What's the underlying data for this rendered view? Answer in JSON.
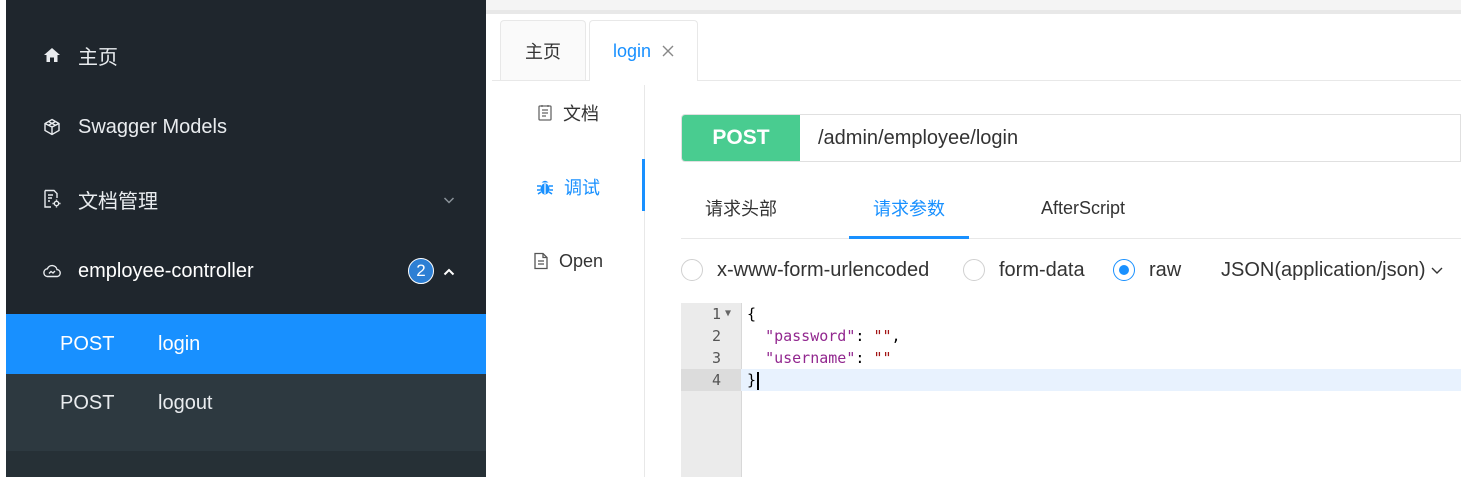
{
  "sidebar": {
    "items": [
      {
        "label": "主页",
        "icon": "home-icon"
      },
      {
        "label": "Swagger Models",
        "icon": "cube-icon"
      },
      {
        "label": "文档管理",
        "icon": "doc-settings-icon"
      },
      {
        "label": "employee-controller",
        "icon": "cloud-icon",
        "badge": "2"
      }
    ],
    "sub_items": [
      {
        "method": "POST",
        "name": "login"
      },
      {
        "method": "POST",
        "name": "logout"
      }
    ]
  },
  "tabs": [
    {
      "label": "主页"
    },
    {
      "label": "login"
    }
  ],
  "vmenu": [
    {
      "label": "文档",
      "icon": "document-icon"
    },
    {
      "label": "调试",
      "icon": "bug-icon"
    },
    {
      "label": "Open",
      "icon": "file-icon"
    }
  ],
  "request": {
    "method": "POST",
    "url": "/admin/employee/login"
  },
  "subtabs": [
    "请求头部",
    "请求参数",
    "AfterScript"
  ],
  "body_types": [
    "x-www-form-urlencoded",
    "form-data",
    "raw"
  ],
  "content_type": "JSON(application/json)",
  "editor": {
    "line_numbers": [
      "1",
      "2",
      "3",
      "4"
    ],
    "open_brace": "{",
    "close_brace": "}",
    "fields": [
      {
        "key": "\"password\"",
        "value": "\"\""
      },
      {
        "key": "\"username\"",
        "value": "\"\""
      }
    ]
  },
  "colors": {
    "sidebar_bg": "#1f262d",
    "active_blue": "#1890ff",
    "post_green": "#49cc90"
  }
}
